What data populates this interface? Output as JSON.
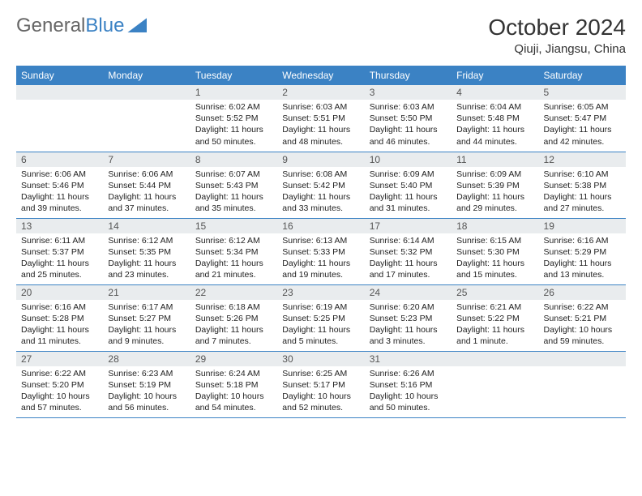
{
  "brand": {
    "part1": "General",
    "part2": "Blue"
  },
  "header": {
    "month_title": "October 2024",
    "location": "Qiuji, Jiangsu, China"
  },
  "weekdays": [
    "Sunday",
    "Monday",
    "Tuesday",
    "Wednesday",
    "Thursday",
    "Friday",
    "Saturday"
  ],
  "weeks": [
    [
      null,
      null,
      {
        "d": "1",
        "sr": "Sunrise: 6:02 AM",
        "ss": "Sunset: 5:52 PM",
        "dl": "Daylight: 11 hours and 50 minutes."
      },
      {
        "d": "2",
        "sr": "Sunrise: 6:03 AM",
        "ss": "Sunset: 5:51 PM",
        "dl": "Daylight: 11 hours and 48 minutes."
      },
      {
        "d": "3",
        "sr": "Sunrise: 6:03 AM",
        "ss": "Sunset: 5:50 PM",
        "dl": "Daylight: 11 hours and 46 minutes."
      },
      {
        "d": "4",
        "sr": "Sunrise: 6:04 AM",
        "ss": "Sunset: 5:48 PM",
        "dl": "Daylight: 11 hours and 44 minutes."
      },
      {
        "d": "5",
        "sr": "Sunrise: 6:05 AM",
        "ss": "Sunset: 5:47 PM",
        "dl": "Daylight: 11 hours and 42 minutes."
      }
    ],
    [
      {
        "d": "6",
        "sr": "Sunrise: 6:06 AM",
        "ss": "Sunset: 5:46 PM",
        "dl": "Daylight: 11 hours and 39 minutes."
      },
      {
        "d": "7",
        "sr": "Sunrise: 6:06 AM",
        "ss": "Sunset: 5:44 PM",
        "dl": "Daylight: 11 hours and 37 minutes."
      },
      {
        "d": "8",
        "sr": "Sunrise: 6:07 AM",
        "ss": "Sunset: 5:43 PM",
        "dl": "Daylight: 11 hours and 35 minutes."
      },
      {
        "d": "9",
        "sr": "Sunrise: 6:08 AM",
        "ss": "Sunset: 5:42 PM",
        "dl": "Daylight: 11 hours and 33 minutes."
      },
      {
        "d": "10",
        "sr": "Sunrise: 6:09 AM",
        "ss": "Sunset: 5:40 PM",
        "dl": "Daylight: 11 hours and 31 minutes."
      },
      {
        "d": "11",
        "sr": "Sunrise: 6:09 AM",
        "ss": "Sunset: 5:39 PM",
        "dl": "Daylight: 11 hours and 29 minutes."
      },
      {
        "d": "12",
        "sr": "Sunrise: 6:10 AM",
        "ss": "Sunset: 5:38 PM",
        "dl": "Daylight: 11 hours and 27 minutes."
      }
    ],
    [
      {
        "d": "13",
        "sr": "Sunrise: 6:11 AM",
        "ss": "Sunset: 5:37 PM",
        "dl": "Daylight: 11 hours and 25 minutes."
      },
      {
        "d": "14",
        "sr": "Sunrise: 6:12 AM",
        "ss": "Sunset: 5:35 PM",
        "dl": "Daylight: 11 hours and 23 minutes."
      },
      {
        "d": "15",
        "sr": "Sunrise: 6:12 AM",
        "ss": "Sunset: 5:34 PM",
        "dl": "Daylight: 11 hours and 21 minutes."
      },
      {
        "d": "16",
        "sr": "Sunrise: 6:13 AM",
        "ss": "Sunset: 5:33 PM",
        "dl": "Daylight: 11 hours and 19 minutes."
      },
      {
        "d": "17",
        "sr": "Sunrise: 6:14 AM",
        "ss": "Sunset: 5:32 PM",
        "dl": "Daylight: 11 hours and 17 minutes."
      },
      {
        "d": "18",
        "sr": "Sunrise: 6:15 AM",
        "ss": "Sunset: 5:30 PM",
        "dl": "Daylight: 11 hours and 15 minutes."
      },
      {
        "d": "19",
        "sr": "Sunrise: 6:16 AM",
        "ss": "Sunset: 5:29 PM",
        "dl": "Daylight: 11 hours and 13 minutes."
      }
    ],
    [
      {
        "d": "20",
        "sr": "Sunrise: 6:16 AM",
        "ss": "Sunset: 5:28 PM",
        "dl": "Daylight: 11 hours and 11 minutes."
      },
      {
        "d": "21",
        "sr": "Sunrise: 6:17 AM",
        "ss": "Sunset: 5:27 PM",
        "dl": "Daylight: 11 hours and 9 minutes."
      },
      {
        "d": "22",
        "sr": "Sunrise: 6:18 AM",
        "ss": "Sunset: 5:26 PM",
        "dl": "Daylight: 11 hours and 7 minutes."
      },
      {
        "d": "23",
        "sr": "Sunrise: 6:19 AM",
        "ss": "Sunset: 5:25 PM",
        "dl": "Daylight: 11 hours and 5 minutes."
      },
      {
        "d": "24",
        "sr": "Sunrise: 6:20 AM",
        "ss": "Sunset: 5:23 PM",
        "dl": "Daylight: 11 hours and 3 minutes."
      },
      {
        "d": "25",
        "sr": "Sunrise: 6:21 AM",
        "ss": "Sunset: 5:22 PM",
        "dl": "Daylight: 11 hours and 1 minute."
      },
      {
        "d": "26",
        "sr": "Sunrise: 6:22 AM",
        "ss": "Sunset: 5:21 PM",
        "dl": "Daylight: 10 hours and 59 minutes."
      }
    ],
    [
      {
        "d": "27",
        "sr": "Sunrise: 6:22 AM",
        "ss": "Sunset: 5:20 PM",
        "dl": "Daylight: 10 hours and 57 minutes."
      },
      {
        "d": "28",
        "sr": "Sunrise: 6:23 AM",
        "ss": "Sunset: 5:19 PM",
        "dl": "Daylight: 10 hours and 56 minutes."
      },
      {
        "d": "29",
        "sr": "Sunrise: 6:24 AM",
        "ss": "Sunset: 5:18 PM",
        "dl": "Daylight: 10 hours and 54 minutes."
      },
      {
        "d": "30",
        "sr": "Sunrise: 6:25 AM",
        "ss": "Sunset: 5:17 PM",
        "dl": "Daylight: 10 hours and 52 minutes."
      },
      {
        "d": "31",
        "sr": "Sunrise: 6:26 AM",
        "ss": "Sunset: 5:16 PM",
        "dl": "Daylight: 10 hours and 50 minutes."
      },
      null,
      null
    ]
  ]
}
